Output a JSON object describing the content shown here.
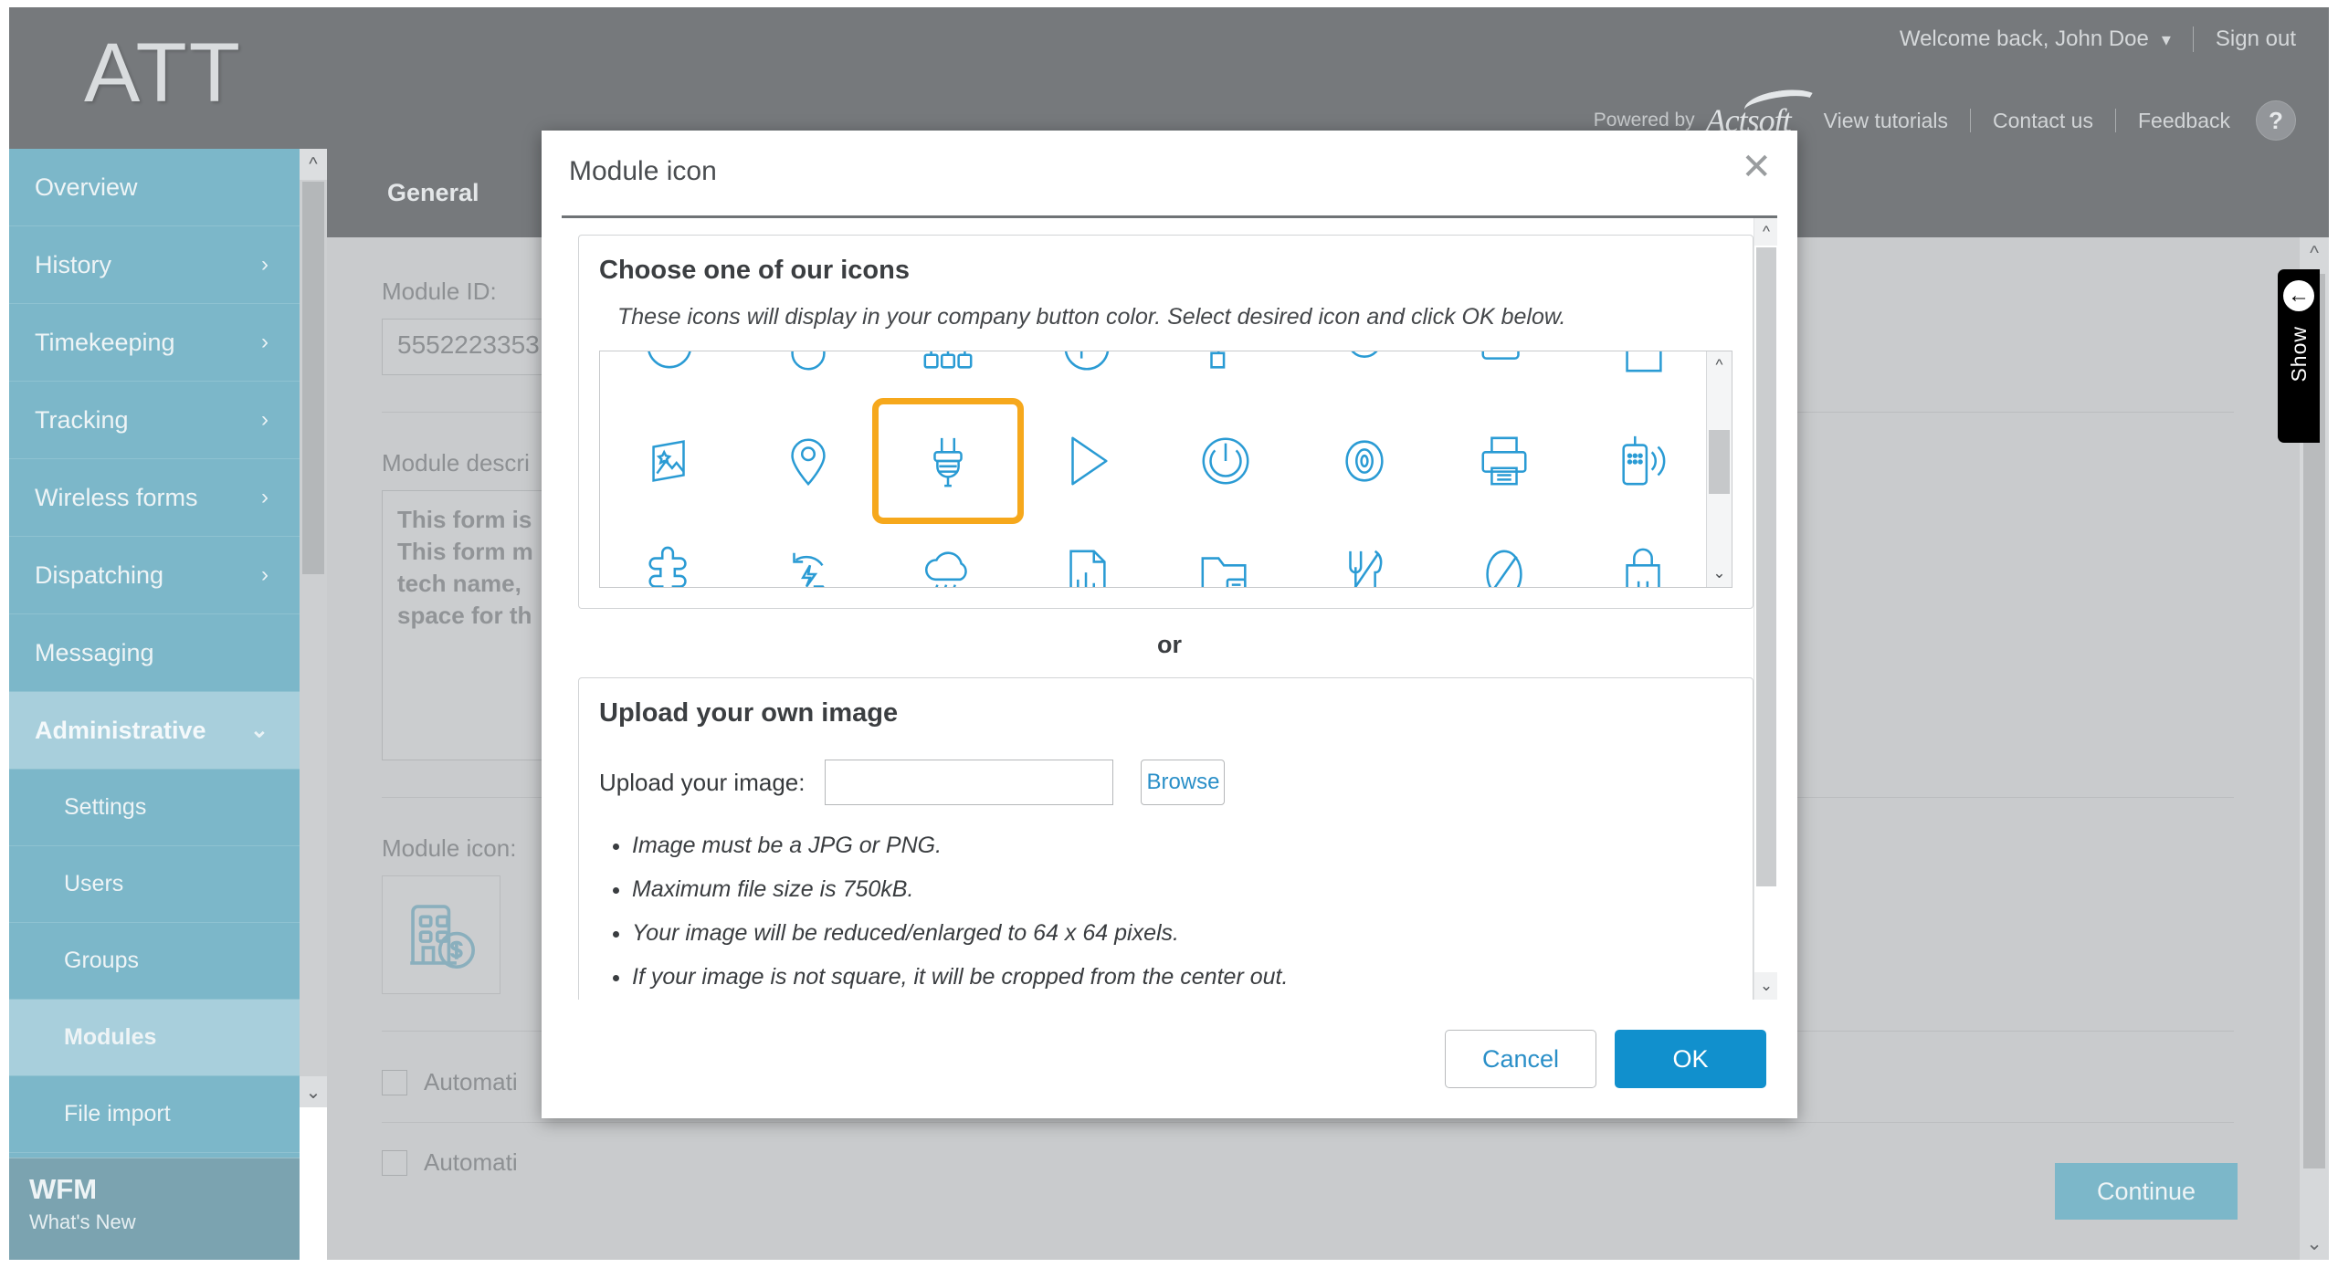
{
  "header": {
    "brand": "ATT",
    "welcome": "Welcome back, John Doe",
    "caret_icon": "chevron-down-icon",
    "sign_out": "Sign out",
    "powered_by": "Powered by",
    "actsoft": "Actsoft",
    "links": [
      "View tutorials",
      "Contact us",
      "Feedback"
    ],
    "help": "?"
  },
  "sidebar": {
    "items": [
      {
        "label": "Overview",
        "chevron": ""
      },
      {
        "label": "History",
        "chevron": "›"
      },
      {
        "label": "Timekeeping",
        "chevron": "›"
      },
      {
        "label": "Tracking",
        "chevron": "›"
      },
      {
        "label": "Wireless forms",
        "chevron": "›"
      },
      {
        "label": "Dispatching",
        "chevron": "›"
      },
      {
        "label": "Messaging",
        "chevron": ""
      },
      {
        "label": "Administrative",
        "chevron": "⌄"
      }
    ],
    "subitems": [
      {
        "label": "Settings"
      },
      {
        "label": "Users"
      },
      {
        "label": "Groups"
      },
      {
        "label": "Modules"
      },
      {
        "label": "File import"
      }
    ],
    "footer": {
      "title": "WFM",
      "subtitle": "What's New"
    },
    "scroll_up_icon": "chevron-up-icon",
    "scroll_down_icon": "chevron-down-icon"
  },
  "main": {
    "tab": "General",
    "module_id_label": "Module ID:",
    "module_id_value": "5552223353",
    "module_desc_label": "Module descri",
    "module_desc_value": "This form is\nThis form m\ntech name,\nspace for th",
    "module_icon_label": "Module icon:",
    "module_icon_name": "building-dollar-icon",
    "checkbox1": "Automati",
    "checkbox2": "Automati",
    "continue_label": "Continue"
  },
  "show_tab": {
    "label": "Show",
    "arrow_icon": "arrow-left-circle-icon"
  },
  "modal": {
    "title": "Module icon",
    "close_icon": "close-icon",
    "choose_title": "Choose one of our icons",
    "choose_note": "These icons will display in your company button color. Select desired icon and click OK below.",
    "or": "or",
    "upload_title": "Upload your own image",
    "upload_label": "Upload your image:",
    "upload_value": "",
    "upload_placeholder": "",
    "browse_label": "Browse",
    "rules": [
      "Image must be a JPG or PNG.",
      "Maximum file size is 750kB.",
      "Your image will be reduced/enlarged to 64 x 64 pixels.",
      "If your image is not square, it will be cropped from the center out."
    ],
    "cancel_label": "Cancel",
    "ok_label": "OK",
    "selected_icon": "plug-icon",
    "icons": [
      {
        "name": "clock-icon",
        "row": 0
      },
      {
        "name": "drop-icon",
        "row": 0
      },
      {
        "name": "org-chart-icon",
        "row": 0
      },
      {
        "name": "parking-icon",
        "row": 0
      },
      {
        "name": "paint-roller-icon",
        "row": 0
      },
      {
        "name": "paint-bucket-icon",
        "row": 0
      },
      {
        "name": "pan-icon",
        "row": 0
      },
      {
        "name": "pdf-file-icon",
        "row": 0
      },
      {
        "name": "photos-icon",
        "row": 1
      },
      {
        "name": "pin-icon",
        "row": 1
      },
      {
        "name": "plug-icon",
        "row": 1
      },
      {
        "name": "play-icon",
        "row": 1
      },
      {
        "name": "power-icon",
        "row": 1
      },
      {
        "name": "eye-icon",
        "row": 1
      },
      {
        "name": "printer-icon",
        "row": 1
      },
      {
        "name": "radio-icon",
        "row": 1
      },
      {
        "name": "puzzle-icon",
        "row": 1
      },
      {
        "name": "recycle-power-icon",
        "row": 2
      },
      {
        "name": "rain-cloud-icon",
        "row": 2
      },
      {
        "name": "report-chart-icon",
        "row": 2
      },
      {
        "name": "folder-doc-icon",
        "row": 2
      },
      {
        "name": "restaurant-icon",
        "row": 2
      },
      {
        "name": "no-entry-icon",
        "row": 2
      },
      {
        "name": "shopping-bag-icon",
        "row": 2
      },
      {
        "name": "router-icon",
        "row": 2
      },
      {
        "name": "sales-report-icon",
        "row": 2
      }
    ],
    "colors": {
      "icon_blue": "#2a9bd4",
      "selected_outline": "#f6a81c",
      "ok_button": "#1190cd",
      "link_blue": "#2a8fc8"
    }
  }
}
